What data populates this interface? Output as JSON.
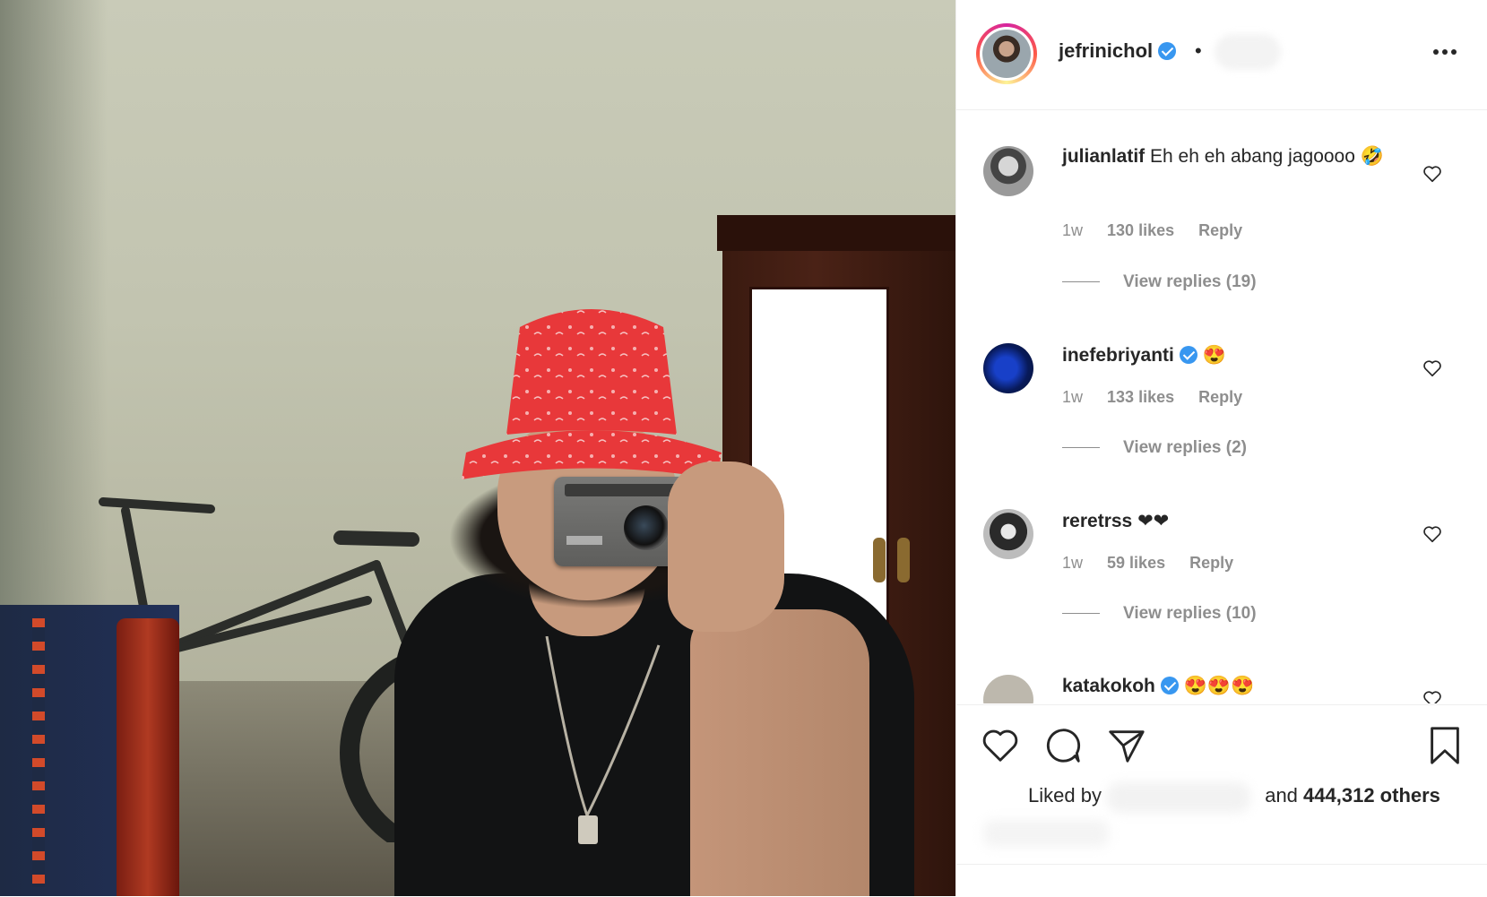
{
  "post": {
    "username": "jefrinichol",
    "verified": true,
    "separator": "•"
  },
  "comments": [
    {
      "username": "julianlatif",
      "text": "Eh eh eh abang jagoooo 🤣",
      "time": "1w",
      "likes": "130 likes",
      "reply_label": "Reply",
      "view_replies": "View replies (19)"
    },
    {
      "username": "inefebriyanti",
      "verified": true,
      "text": "😍",
      "time": "1w",
      "likes": "133 likes",
      "reply_label": "Reply",
      "view_replies": "View replies (2)"
    },
    {
      "username": "reretrss",
      "text": "❤❤",
      "time": "1w",
      "likes": "59 likes",
      "reply_label": "Reply",
      "view_replies": "View replies (10)"
    },
    {
      "username": "katakokoh",
      "verified": true,
      "text": "😍😍😍"
    }
  ],
  "actions": {
    "like_icon": "heart-icon",
    "comment_icon": "comment-icon",
    "share_icon": "paper-plane-icon",
    "save_icon": "bookmark-icon"
  },
  "liked_by": {
    "prefix": "Liked by",
    "connector": "and",
    "count": "444,312 others"
  },
  "colors": {
    "verified": "#3897f0",
    "meta_text": "#8e8e8e",
    "primary_text": "#262626",
    "story_ring_start": "#d6249f",
    "story_ring_end": "#fdf497"
  }
}
